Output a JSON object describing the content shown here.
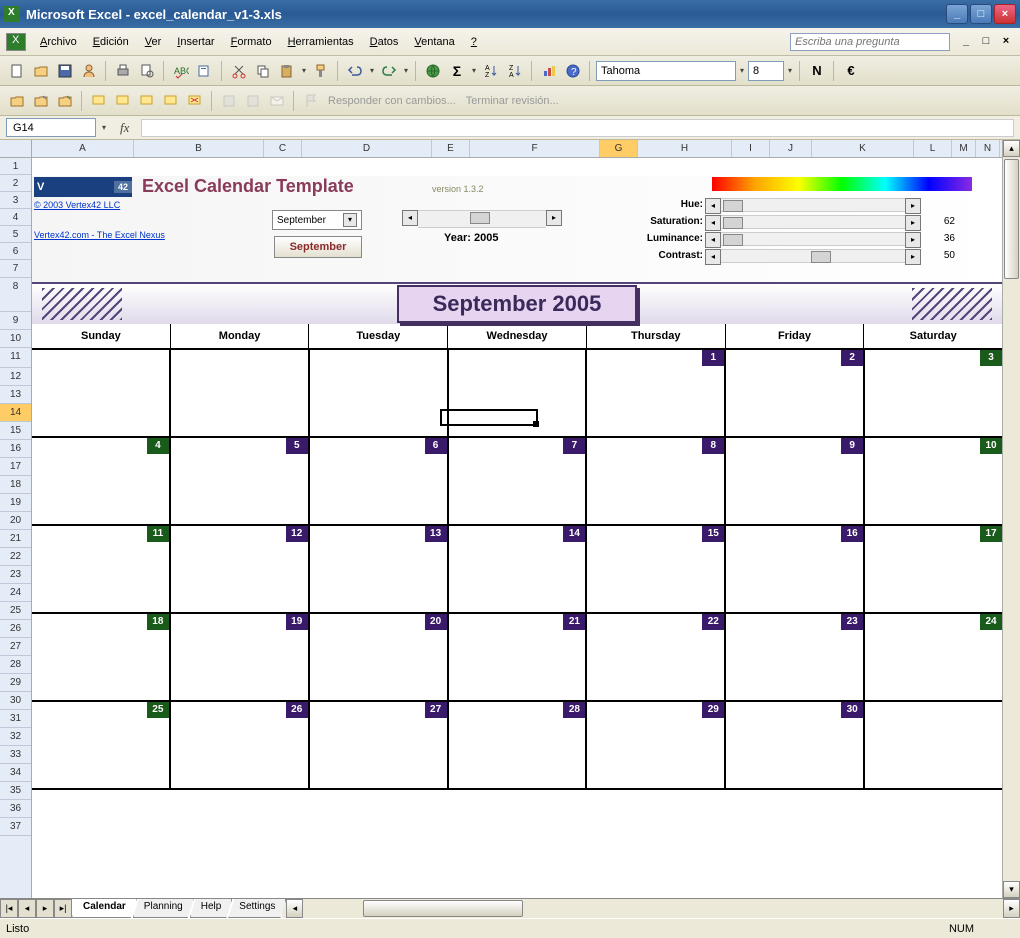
{
  "title": "Microsoft Excel - excel_calendar_v1-3.xls",
  "menus": [
    "Archivo",
    "Edición",
    "Ver",
    "Insertar",
    "Formato",
    "Herramientas",
    "Datos",
    "Ventana",
    "?"
  ],
  "menu_keys": [
    "A",
    "E",
    "V",
    "I",
    "F",
    "H",
    "D",
    "V",
    "?"
  ],
  "ask_placeholder": "Escriba una pregunta",
  "font": {
    "name": "Tahoma",
    "size": "8"
  },
  "bold": "N",
  "euro": "€",
  "review": {
    "respond": "Responder con cambios...",
    "end": "Terminar revisión..."
  },
  "name_box": "G14",
  "fx": "fx",
  "cols": [
    "A",
    "B",
    "C",
    "D",
    "E",
    "F",
    "G",
    "H",
    "I",
    "J",
    "K",
    "L",
    "M",
    "N"
  ],
  "rows": [
    "1",
    "2",
    "3",
    "4",
    "5",
    "6",
    "7",
    "8",
    "9",
    "10",
    "11",
    "12",
    "13",
    "14",
    "15",
    "16",
    "17",
    "18",
    "19",
    "20",
    "21",
    "22",
    "23",
    "24",
    "25",
    "26",
    "27",
    "28",
    "29",
    "30",
    "31",
    "32",
    "33",
    "34",
    "35",
    "36",
    "37"
  ],
  "active_col": "G",
  "active_row": "14",
  "logo": {
    "text": "V",
    "num": "42"
  },
  "template_title": "Excel Calendar Template",
  "version": "version 1.3.2",
  "copy_link": "© 2003 Vertex42 LLC",
  "site_link": "Vertex42.com - The Excel Nexus",
  "month_select": "September",
  "sept_button": "September",
  "year_label": "Year: 2005",
  "sliders": {
    "hue": {
      "label": "Hue:",
      "val": ""
    },
    "sat": {
      "label": "Saturation:",
      "val": "62"
    },
    "lum": {
      "label": "Luminance:",
      "val": "36"
    },
    "con": {
      "label": "Contrast:",
      "val": "50"
    }
  },
  "cal_title": "September 2005",
  "days": [
    "Sunday",
    "Monday",
    "Tuesday",
    "Wednesday",
    "Thursday",
    "Friday",
    "Saturday"
  ],
  "weeks": [
    [
      null,
      null,
      null,
      null,
      {
        "n": "1",
        "c": "p"
      },
      {
        "n": "2",
        "c": "p"
      },
      {
        "n": "3",
        "c": "g"
      }
    ],
    [
      {
        "n": "4",
        "c": "g"
      },
      {
        "n": "5",
        "c": "p"
      },
      {
        "n": "6",
        "c": "p"
      },
      {
        "n": "7",
        "c": "p"
      },
      {
        "n": "8",
        "c": "p"
      },
      {
        "n": "9",
        "c": "p"
      },
      {
        "n": "10",
        "c": "g"
      }
    ],
    [
      {
        "n": "11",
        "c": "g"
      },
      {
        "n": "12",
        "c": "p"
      },
      {
        "n": "13",
        "c": "p"
      },
      {
        "n": "14",
        "c": "p"
      },
      {
        "n": "15",
        "c": "p"
      },
      {
        "n": "16",
        "c": "p"
      },
      {
        "n": "17",
        "c": "g"
      }
    ],
    [
      {
        "n": "18",
        "c": "g"
      },
      {
        "n": "19",
        "c": "p"
      },
      {
        "n": "20",
        "c": "p"
      },
      {
        "n": "21",
        "c": "p"
      },
      {
        "n": "22",
        "c": "p"
      },
      {
        "n": "23",
        "c": "p"
      },
      {
        "n": "24",
        "c": "g"
      }
    ],
    [
      {
        "n": "25",
        "c": "g"
      },
      {
        "n": "26",
        "c": "p"
      },
      {
        "n": "27",
        "c": "p"
      },
      {
        "n": "28",
        "c": "p"
      },
      {
        "n": "29",
        "c": "p"
      },
      {
        "n": "30",
        "c": "p"
      },
      null
    ]
  ],
  "tabs": [
    "Calendar",
    "Planning",
    "Help",
    "Settings"
  ],
  "active_tab": 0,
  "status": "Listo",
  "numlock": "NUM"
}
